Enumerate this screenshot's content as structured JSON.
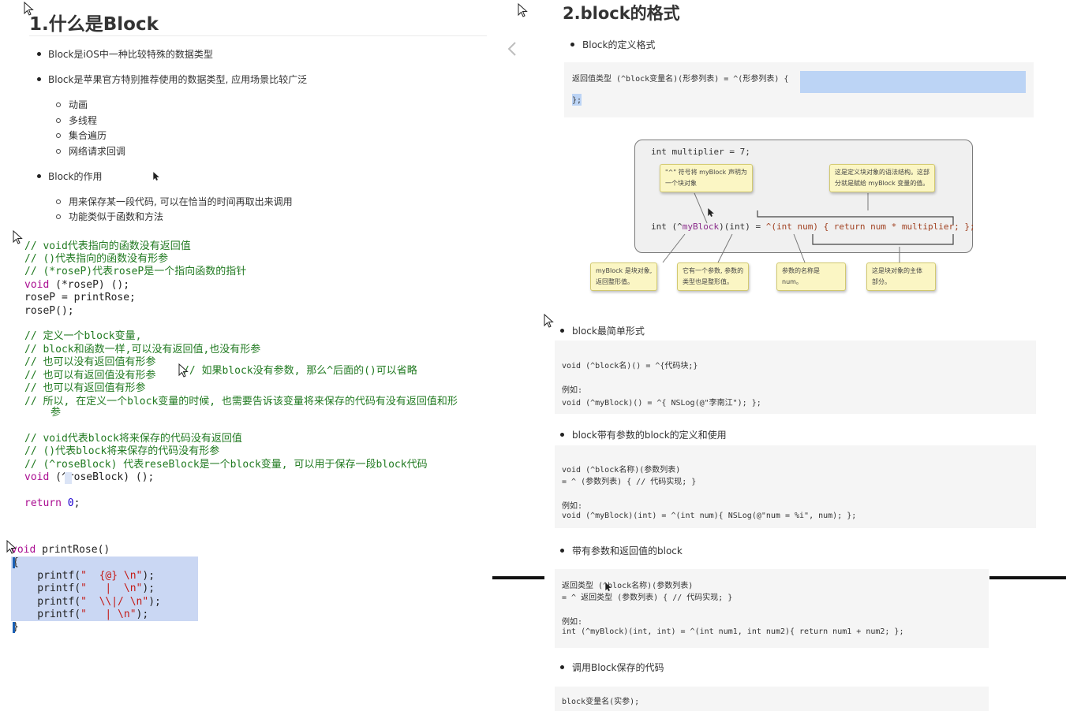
{
  "left": {
    "heading": "1.什么是Block",
    "bullets": [
      "Block是iOS中一种比较特殊的数据类型",
      "Block是苹果官方特别推荐使用的数据类型, 应用场景比较广泛"
    ],
    "sub_bullets_1": [
      "动画",
      "多线程",
      "集合遍历",
      "网络请求回调"
    ],
    "bullet_role": "Block的作用",
    "sub_bullets_2": [
      "用来保存某一段代码, 可以在恰当的时间再取出来调用",
      "功能类似于函数和方法"
    ]
  },
  "code": {
    "c1": "// void代表指向的函数没有返回值",
    "c2": "// ()代表指向的函数没有形参",
    "c3": "// (*roseP)代表roseP是一个指向函数的指针",
    "l4a": "void",
    "l4b": " (*roseP) ();",
    "l5": "roseP = printRose;",
    "l6": "roseP();",
    "c7": "// 定义一个block变量,",
    "c8": "// block和函数一样,可以没有返回值,也没有形参",
    "c9": "// 也可以没有返回值有形参",
    "c9b": "// 如果block没有参数, 那么^后面的()可以省略",
    "c10": "// 也可以有返回值没有形参",
    "c11": "// 也可以有返回值有形参",
    "c12": "// 所以, 在定义一个block变量的时候, 也需要告诉该变量将来保存的代码有没有返回值和形",
    "c12b": "参",
    "c13": "// void代表block将来保存的代码没有返回值",
    "c14": "// ()代表block将来保存的代码没有形参",
    "c15": "// (^roseBlock) 代表reseBlock是一个block变量, 可以用于保存一段block代码",
    "l16a": "void",
    "l16b": " (^roseBlock) ();",
    "l17a": "return",
    "l17b": "0",
    "l17c": ";",
    "f1a": "void",
    "f1b": " printRose()",
    "f2": "{",
    "p1a": "    printf(",
    "p1b": "\"  {@} \\n\"",
    "p1c": ");",
    "p2b": "\"   |  \\n\"",
    "p3b": "\"  \\\\|/ \\n\"",
    "p4b": "\"   | \\n\"",
    "f3": "}"
  },
  "right": {
    "heading": "2.block的格式",
    "b1": "Block的定义格式",
    "def_line1": "返回值类型 (^block变量名)(形参列表) = ^(形参列表) {",
    "def_line2": "};",
    "diagram": {
      "top": "int multiplier = 7;",
      "main_a": "int (^",
      "main_b": "myBlock",
      "main_c": ")(int) = ",
      "main_d": "^(int num) { return num * multiplier; };",
      "callout1": [
        "\"^\" 符号将 myBlock 声明为",
        "一个块对象"
      ],
      "callout2": [
        "这是定义块对象的语法结构。这部",
        "分就是赋给 myBlock 变量的值。"
      ],
      "callout3": [
        "myBlock 是块对象,",
        "返回整形值。"
      ],
      "callout4": [
        "它有一个参数, 参数的",
        "类型也是整形值。"
      ],
      "callout5": [
        "参数的名称是",
        "num。"
      ],
      "callout6": [
        "这是块对象的主体",
        "部分。"
      ]
    },
    "b2": "block最简单形式",
    "s2": [
      "void (^block名)() = ^{代码块;}",
      "",
      "例如:",
      "void (^myBlock)() = ^{ NSLog(@\"李南江\"); };"
    ],
    "b3": "block带有参数的block的定义和使用",
    "s3": [
      "void (^block名称)(参数列表)",
      "= ^ (参数列表) { // 代码实现; }",
      "",
      "例如:",
      "void (^myBlock)(int) = ^(int num){ NSLog(@\"num = %i\", num); };"
    ],
    "b4": "带有参数和返回值的block",
    "s4": [
      "返回类型 (^block名称)(参数列表)",
      "= ^ 返回类型 (参数列表) { // 代码实现; }",
      "",
      "例如:",
      "int (^myBlock)(int, int) = ^(int num1, int num2){ return num1 + num2; };"
    ],
    "b5": "调用Block保存的代码",
    "s5": "block变量名(实参);"
  },
  "icons": {
    "back": "chevron-left-icon",
    "pointer": "mouse-pointer-icon"
  },
  "colors": {
    "comment": "#217a21",
    "keyword": "#aa0d91",
    "number": "#1c00cf",
    "string": "#c41a16",
    "selection": "#cad7f3",
    "callout": "#fbf6c4"
  }
}
